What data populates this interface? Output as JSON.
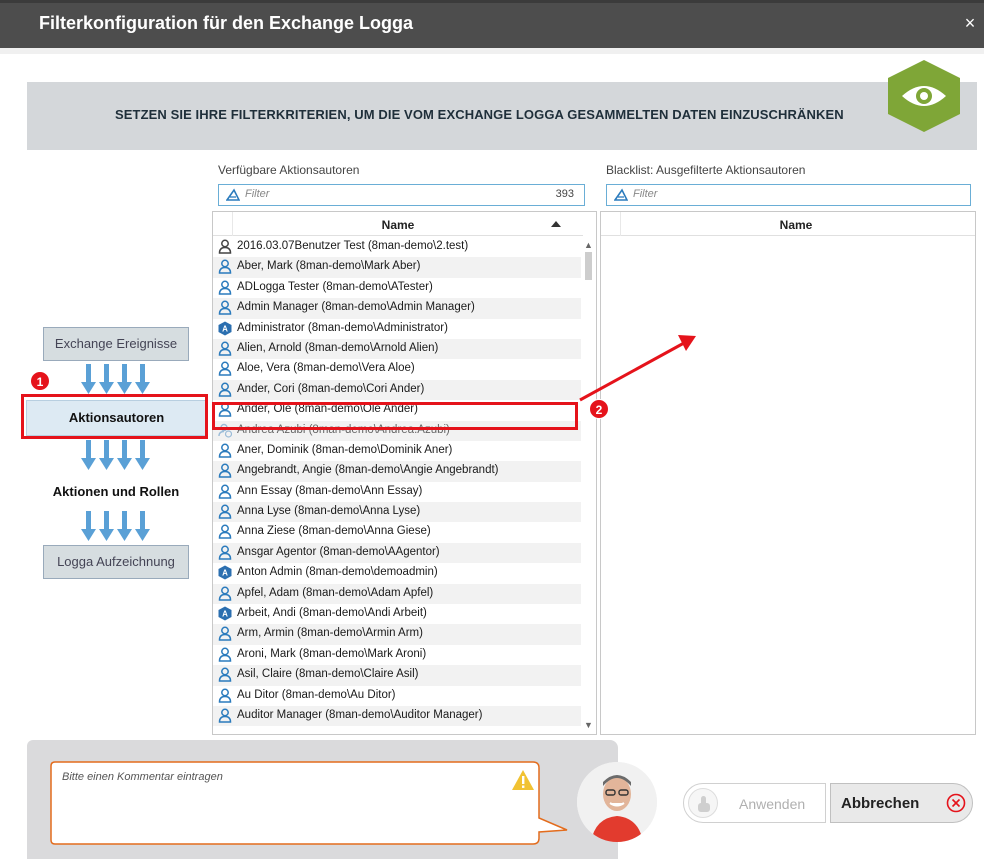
{
  "window": {
    "title": "Filterkonfiguration für den Exchange Logga",
    "close_glyph": "×"
  },
  "banner": {
    "text": "SETZEN SIE IHRE FILTERKRITERIEN, UM DIE VOM EXCHANGE LOGGA GESAMMELTEN DATEN EINZUSCHRÄNKEN",
    "icon": "eye-icon",
    "color": "#7fa637"
  },
  "steps": [
    {
      "label": "Exchange Ereignisse",
      "state": "muted"
    },
    {
      "label": "Aktionsautoren",
      "state": "active"
    },
    {
      "label": "Aktionen und Rollen",
      "state": "plain"
    },
    {
      "label": "Logga Aufzeichnung",
      "state": "muted"
    }
  ],
  "available": {
    "title": "Verfügbare Aktionsautoren",
    "filter_placeholder": "Filter",
    "count": "393",
    "column": "Name",
    "rows": [
      {
        "name": "2016.03.07Benutzer Test (8man-demo\\2.test)",
        "icon": "user-outline-icon"
      },
      {
        "name": "Aber, Mark (8man-demo\\Mark Aber)",
        "icon": "user-icon"
      },
      {
        "name": "ADLogga Tester (8man-demo\\ATester)",
        "icon": "user-icon"
      },
      {
        "name": "Admin Manager (8man-demo\\Admin Manager)",
        "icon": "user-icon"
      },
      {
        "name": "Administrator (8man-demo\\Administrator)",
        "icon": "admin-icon"
      },
      {
        "name": "Alien, Arnold (8man-demo\\Arnold Alien)",
        "icon": "user-icon"
      },
      {
        "name": "Aloe, Vera (8man-demo\\Vera Aloe)",
        "icon": "user-icon"
      },
      {
        "name": "Ander, Cori (8man-demo\\Cori Ander)",
        "icon": "user-icon"
      },
      {
        "name": "Ander, Ole (8man-demo\\Ole Ander)",
        "icon": "user-icon"
      },
      {
        "name": "Andrea Azubi (8man-demo\\Andrea.Azubi)",
        "icon": "disabled-user-icon"
      },
      {
        "name": "Aner, Dominik (8man-demo\\Dominik Aner)",
        "icon": "user-icon"
      },
      {
        "name": "Angebrandt, Angie (8man-demo\\Angie Angebrandt)",
        "icon": "user-icon"
      },
      {
        "name": "Ann Essay (8man-demo\\Ann Essay)",
        "icon": "user-icon"
      },
      {
        "name": "Anna Lyse (8man-demo\\Anna Lyse)",
        "icon": "user-icon"
      },
      {
        "name": "Anna Ziese (8man-demo\\Anna Giese)",
        "icon": "user-icon"
      },
      {
        "name": "Ansgar Agentor (8man-demo\\AAgentor)",
        "icon": "user-icon"
      },
      {
        "name": "Anton Admin (8man-demo\\demoadmin)",
        "icon": "admin-icon"
      },
      {
        "name": "Apfel, Adam (8man-demo\\Adam Apfel)",
        "icon": "user-icon"
      },
      {
        "name": "Arbeit, Andi (8man-demo\\Andi Arbeit)",
        "icon": "admin-icon"
      },
      {
        "name": "Arm, Armin (8man-demo\\Armin Arm)",
        "icon": "user-icon"
      },
      {
        "name": "Aroni, Mark (8man-demo\\Mark Aroni)",
        "icon": "user-icon"
      },
      {
        "name": "Asil, Claire (8man-demo\\Claire Asil)",
        "icon": "user-icon"
      },
      {
        "name": "Au Ditor (8man-demo\\Au Ditor)",
        "icon": "user-icon"
      },
      {
        "name": "Auditor Manager (8man-demo\\Auditor Manager)",
        "icon": "user-icon"
      }
    ]
  },
  "blacklist": {
    "title": "Blacklist: Ausgefilterte Aktionsautoren",
    "filter_placeholder": "Filter",
    "column": "Name"
  },
  "annotations": {
    "badge1": "1",
    "badge2": "2",
    "color": "#e5131b"
  },
  "comment": {
    "placeholder": "Bitte einen Kommentar eintragen",
    "warning_icon": "warning-icon"
  },
  "buttons": {
    "apply": "Anwenden",
    "cancel": "Abbrechen"
  }
}
